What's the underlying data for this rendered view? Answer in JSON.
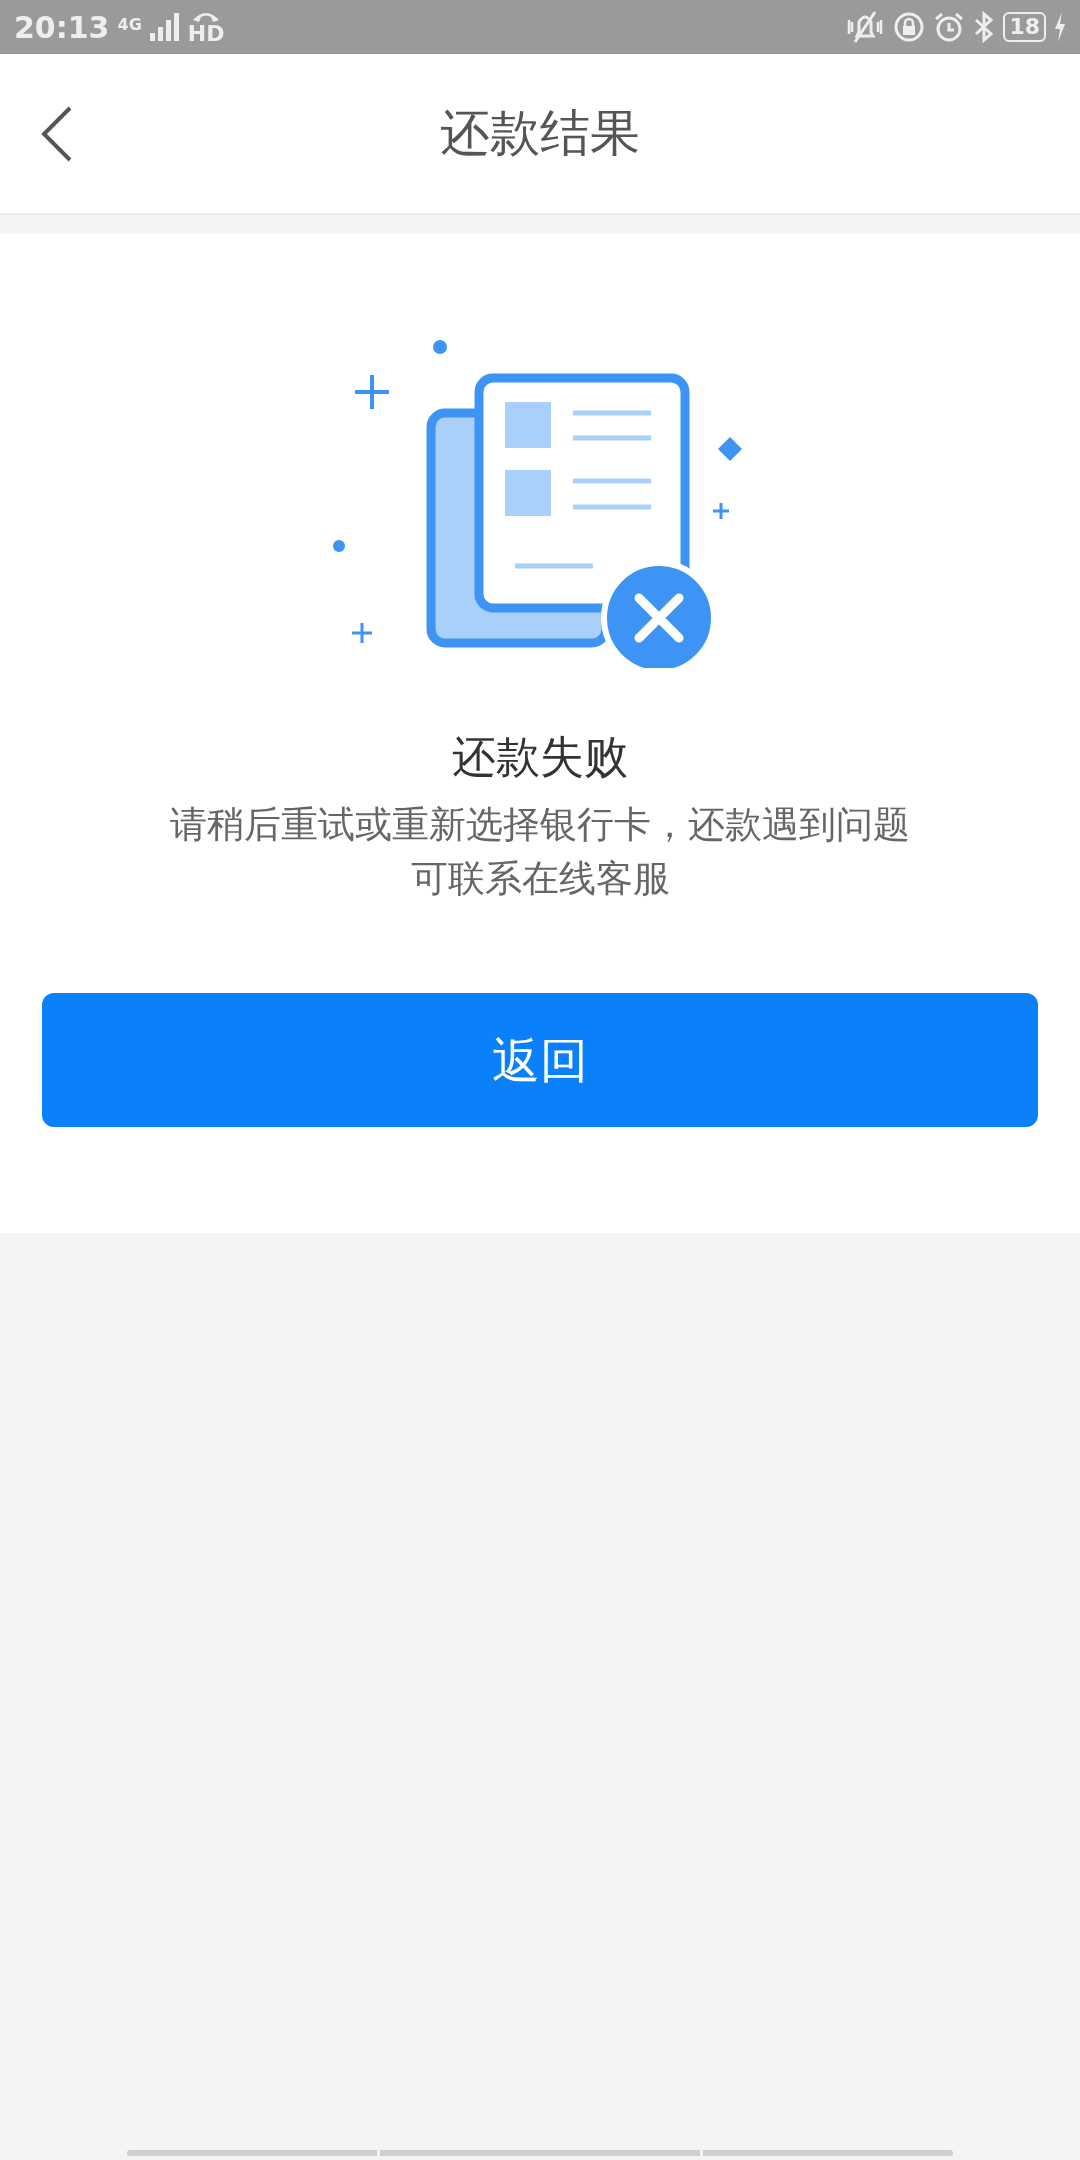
{
  "status_bar": {
    "time": "20:13",
    "network": "4G",
    "hd": "HD",
    "battery": "18"
  },
  "header": {
    "title": "还款结果"
  },
  "result": {
    "title": "还款失败",
    "message": "请稍后重试或重新选择银行卡，还款遇到问题可联系在线客服"
  },
  "button": {
    "label": "返回"
  }
}
